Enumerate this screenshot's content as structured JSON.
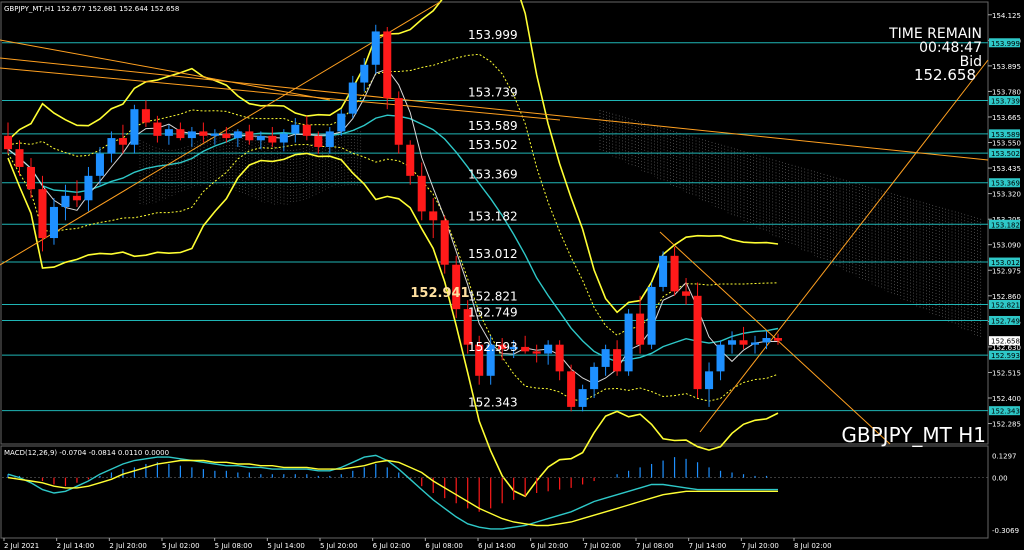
{
  "window": {
    "header": "GBPJPY_MT,H1  152.677 152.681 152.644 152.658",
    "symbol_watermark": "GBPJPY_MT H1"
  },
  "info": {
    "time_remain_label": "TIME REMAIN",
    "time_remain_value": "00:48:47",
    "bid_label": "Bid",
    "bid_value": "152.658"
  },
  "colors": {
    "background": "#000000",
    "bull": "#1e90ff",
    "bear": "#ff1a1a",
    "level_line": "#1fb5b5",
    "bollinger": "#ffff33",
    "trendline": "#ffa020",
    "ma_white": "#d8d8d8",
    "ma_cyan": "#2ec8c8",
    "axis_text": "#ffffff",
    "marker_bg": "#2ec8c8"
  },
  "chart_data": {
    "type": "candlestick",
    "price_axis": {
      "ylim": [
        152.22,
        154.16
      ],
      "ticks": [
        "154.125",
        "154.010",
        "153.895",
        "153.780",
        "153.665",
        "153.550",
        "153.435",
        "153.320",
        "153.205",
        "153.090",
        "152.975",
        "152.860",
        "152.745",
        "152.630",
        "152.515",
        "152.400",
        "152.285"
      ]
    },
    "time_axis": {
      "labels": [
        "2 Jul 2021",
        "2 Jul 14:00",
        "2 Jul 20:00",
        "5 Jul 02:00",
        "5 Jul 08:00",
        "5 Jul 14:00",
        "5 Jul 20:00",
        "6 Jul 02:00",
        "6 Jul 08:00",
        "6 Jul 14:00",
        "6 Jul 20:00",
        "7 Jul 02:00",
        "7 Jul 08:00",
        "7 Jul 14:00",
        "7 Jul 20:00",
        "8 Jul 02:00"
      ]
    },
    "levels": [
      {
        "price": 153.999,
        "label": "153.999",
        "axis_label": "153.999"
      },
      {
        "price": 153.739,
        "label": "153.739",
        "axis_label": "153.739"
      },
      {
        "price": 153.589,
        "label": "153.589",
        "axis_label": "153.589"
      },
      {
        "price": 153.502,
        "label": "153.502",
        "axis_label": "153.502"
      },
      {
        "price": 153.369,
        "label": "153.369",
        "axis_label": "153.369"
      },
      {
        "price": 153.182,
        "label": "153.182",
        "axis_label": "153.182"
      },
      {
        "price": 153.012,
        "label": "153.012",
        "axis_label": "153.012"
      },
      {
        "price": 152.821,
        "label": "152.821",
        "axis_label": "152.821"
      },
      {
        "price": 152.749,
        "label": "152.749",
        "axis_label": "152.749"
      },
      {
        "price": 152.593,
        "label": "152.593",
        "axis_label": "152.593"
      },
      {
        "price": 152.343,
        "label": "152.343",
        "axis_label": "152.343"
      }
    ],
    "highlight_price": "152.941",
    "current_price": "152.658",
    "candles": [
      [
        153.58,
        153.64,
        153.5,
        153.52
      ],
      [
        153.52,
        153.56,
        153.4,
        153.44
      ],
      [
        153.44,
        153.48,
        153.3,
        153.34
      ],
      [
        153.34,
        153.4,
        153.06,
        153.12
      ],
      [
        153.12,
        153.3,
        153.09,
        153.26
      ],
      [
        153.26,
        153.36,
        153.2,
        153.31
      ],
      [
        153.31,
        153.38,
        153.26,
        153.29
      ],
      [
        153.29,
        153.44,
        153.24,
        153.4
      ],
      [
        153.4,
        153.53,
        153.36,
        153.5
      ],
      [
        153.5,
        153.6,
        153.46,
        153.57
      ],
      [
        153.57,
        153.63,
        153.5,
        153.54
      ],
      [
        153.54,
        153.72,
        153.5,
        153.7
      ],
      [
        153.7,
        153.74,
        153.62,
        153.64
      ],
      [
        153.64,
        153.67,
        153.55,
        153.58
      ],
      [
        153.58,
        153.63,
        153.54,
        153.61
      ],
      [
        153.61,
        153.64,
        153.56,
        153.57
      ],
      [
        153.57,
        153.62,
        153.53,
        153.6
      ],
      [
        153.6,
        153.64,
        153.55,
        153.58
      ],
      [
        153.58,
        153.61,
        153.54,
        153.59
      ],
      [
        153.59,
        153.62,
        153.55,
        153.57
      ],
      [
        153.57,
        153.61,
        153.53,
        153.6
      ],
      [
        153.6,
        153.63,
        153.54,
        153.56
      ],
      [
        153.56,
        153.6,
        153.52,
        153.58
      ],
      [
        153.58,
        153.62,
        153.53,
        153.55
      ],
      [
        153.55,
        153.61,
        153.51,
        153.59
      ],
      [
        153.59,
        153.66,
        153.55,
        153.63
      ],
      [
        153.63,
        153.67,
        153.56,
        153.58
      ],
      [
        153.58,
        153.6,
        153.5,
        153.53
      ],
      [
        153.53,
        153.62,
        153.5,
        153.6
      ],
      [
        153.6,
        153.7,
        153.58,
        153.68
      ],
      [
        153.68,
        153.85,
        153.66,
        153.82
      ],
      [
        153.82,
        153.93,
        153.78,
        153.9
      ],
      [
        153.9,
        154.08,
        153.86,
        154.05
      ],
      [
        154.05,
        154.07,
        153.7,
        153.75
      ],
      [
        153.75,
        153.78,
        153.5,
        153.54
      ],
      [
        153.54,
        153.56,
        153.36,
        153.4
      ],
      [
        153.4,
        153.46,
        153.2,
        153.24
      ],
      [
        153.24,
        153.3,
        153.12,
        153.2
      ],
      [
        153.2,
        153.22,
        152.96,
        153.0
      ],
      [
        153.0,
        153.04,
        152.76,
        152.8
      ],
      [
        152.8,
        152.84,
        152.6,
        152.64
      ],
      [
        152.64,
        152.68,
        152.46,
        152.5
      ],
      [
        152.5,
        152.68,
        152.46,
        152.64
      ],
      [
        152.64,
        152.67,
        152.57,
        152.62
      ],
      [
        152.62,
        152.66,
        152.58,
        152.63
      ],
      [
        152.63,
        152.68,
        152.6,
        152.61
      ],
      [
        152.61,
        152.64,
        152.56,
        152.6
      ],
      [
        152.6,
        152.66,
        152.55,
        152.64
      ],
      [
        152.64,
        152.66,
        152.48,
        152.52
      ],
      [
        152.52,
        152.55,
        152.34,
        152.36
      ],
      [
        152.36,
        152.46,
        152.34,
        152.44
      ],
      [
        152.44,
        152.56,
        152.4,
        152.54
      ],
      [
        152.54,
        152.64,
        152.5,
        152.62
      ],
      [
        152.62,
        152.66,
        152.5,
        152.52
      ],
      [
        152.52,
        152.8,
        152.5,
        152.78
      ],
      [
        152.78,
        152.86,
        152.6,
        152.64
      ],
      [
        152.64,
        152.92,
        152.62,
        152.9
      ],
      [
        152.9,
        153.06,
        152.88,
        153.04
      ],
      [
        153.04,
        153.08,
        152.86,
        152.88
      ],
      [
        152.88,
        152.94,
        152.82,
        152.86
      ],
      [
        152.86,
        152.92,
        152.4,
        152.44
      ],
      [
        152.44,
        152.56,
        152.36,
        152.52
      ],
      [
        152.52,
        152.66,
        152.48,
        152.64
      ],
      [
        152.64,
        152.7,
        152.6,
        152.66
      ],
      [
        152.66,
        152.72,
        152.62,
        152.64
      ],
      [
        152.64,
        152.68,
        152.6,
        152.65
      ],
      [
        152.65,
        152.7,
        152.62,
        152.67
      ],
      [
        152.67,
        152.69,
        152.64,
        152.658
      ]
    ]
  },
  "macd": {
    "label": "MACD(12,26,9) -0.0704 -0.0814 0.0110 0.0000",
    "scale_top": "0.1297",
    "scale_mid": "0.00",
    "scale_bottom": "-0.3069",
    "ylim": [
      -0.33,
      0.15
    ],
    "histogram": [
      0.02,
      0.01,
      0.0,
      -0.02,
      -0.04,
      -0.05,
      -0.03,
      -0.01,
      0.01,
      0.03,
      0.05,
      0.06,
      0.08,
      0.09,
      0.08,
      0.07,
      0.06,
      0.05,
      0.04,
      0.04,
      0.03,
      0.03,
      0.02,
      0.02,
      0.02,
      0.02,
      0.02,
      0.01,
      0.01,
      0.02,
      0.04,
      0.06,
      0.08,
      0.06,
      0.03,
      -0.01,
      -0.05,
      -0.09,
      -0.12,
      -0.15,
      -0.18,
      -0.2,
      -0.18,
      -0.15,
      -0.13,
      -0.11,
      -0.09,
      -0.08,
      -0.07,
      -0.06,
      -0.04,
      -0.02,
      0.0,
      0.02,
      0.04,
      0.06,
      0.08,
      0.1,
      0.12,
      0.11,
      0.09,
      0.06,
      0.04,
      0.03,
      0.02,
      0.01,
      0.01,
      0.0
    ],
    "macd_line": [
      0.02,
      0.0,
      -0.03,
      -0.07,
      -0.09,
      -0.08,
      -0.05,
      -0.02,
      0.02,
      0.05,
      0.08,
      0.1,
      0.11,
      0.12,
      0.12,
      0.11,
      0.1,
      0.09,
      0.08,
      0.07,
      0.07,
      0.06,
      0.06,
      0.05,
      0.05,
      0.05,
      0.05,
      0.04,
      0.04,
      0.06,
      0.09,
      0.12,
      0.13,
      0.1,
      0.05,
      -0.01,
      -0.07,
      -0.13,
      -0.18,
      -0.23,
      -0.27,
      -0.29,
      -0.3,
      -0.3,
      -0.29,
      -0.28,
      -0.26,
      -0.24,
      -0.22,
      -0.2,
      -0.17,
      -0.14,
      -0.12,
      -0.1,
      -0.08,
      -0.06,
      -0.04,
      -0.04,
      -0.05,
      -0.06,
      -0.07,
      -0.07,
      -0.07,
      -0.07,
      -0.07,
      -0.07,
      -0.07,
      -0.07
    ],
    "signal_line": [
      0.0,
      -0.01,
      -0.02,
      -0.03,
      -0.05,
      -0.06,
      -0.06,
      -0.05,
      -0.03,
      -0.01,
      0.02,
      0.04,
      0.06,
      0.08,
      0.09,
      0.1,
      0.1,
      0.1,
      0.09,
      0.09,
      0.08,
      0.08,
      0.07,
      0.07,
      0.06,
      0.06,
      0.06,
      0.05,
      0.05,
      0.05,
      0.06,
      0.07,
      0.09,
      0.1,
      0.09,
      0.06,
      0.03,
      -0.02,
      -0.06,
      -0.1,
      -0.14,
      -0.18,
      -0.21,
      -0.24,
      -0.26,
      -0.27,
      -0.28,
      -0.28,
      -0.27,
      -0.26,
      -0.24,
      -0.22,
      -0.2,
      -0.18,
      -0.16,
      -0.14,
      -0.12,
      -0.1,
      -0.09,
      -0.08,
      -0.08,
      -0.08,
      -0.08,
      -0.08,
      -0.08,
      -0.08,
      -0.08,
      -0.08
    ]
  }
}
